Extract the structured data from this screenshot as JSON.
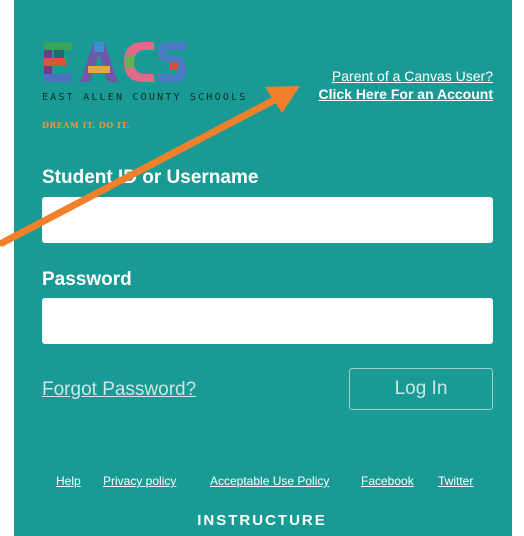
{
  "logo": {
    "letters": "EACS",
    "name": "EAST ALLEN COUNTY SCHOOLS",
    "tagline": "DREAM IT. DO IT."
  },
  "parent_link": {
    "line1": "Parent of a Canvas User?",
    "line2": "Click Here For an Account"
  },
  "form": {
    "username_label": "Student ID or Username",
    "username_value": "",
    "password_label": "Password",
    "password_value": "",
    "forgot_label": "Forgot Password?",
    "login_label": "Log In"
  },
  "footer": {
    "links": [
      "Help",
      "Privacy policy",
      "Acceptable Use Policy",
      "Facebook",
      "Twitter"
    ],
    "brand": "INSTRUCTURE"
  },
  "colors": {
    "panel_bg": "#1a9a94",
    "arrow": "#f0802a",
    "tagline": "#f3952d"
  },
  "icons": [
    "annotation-arrow"
  ]
}
